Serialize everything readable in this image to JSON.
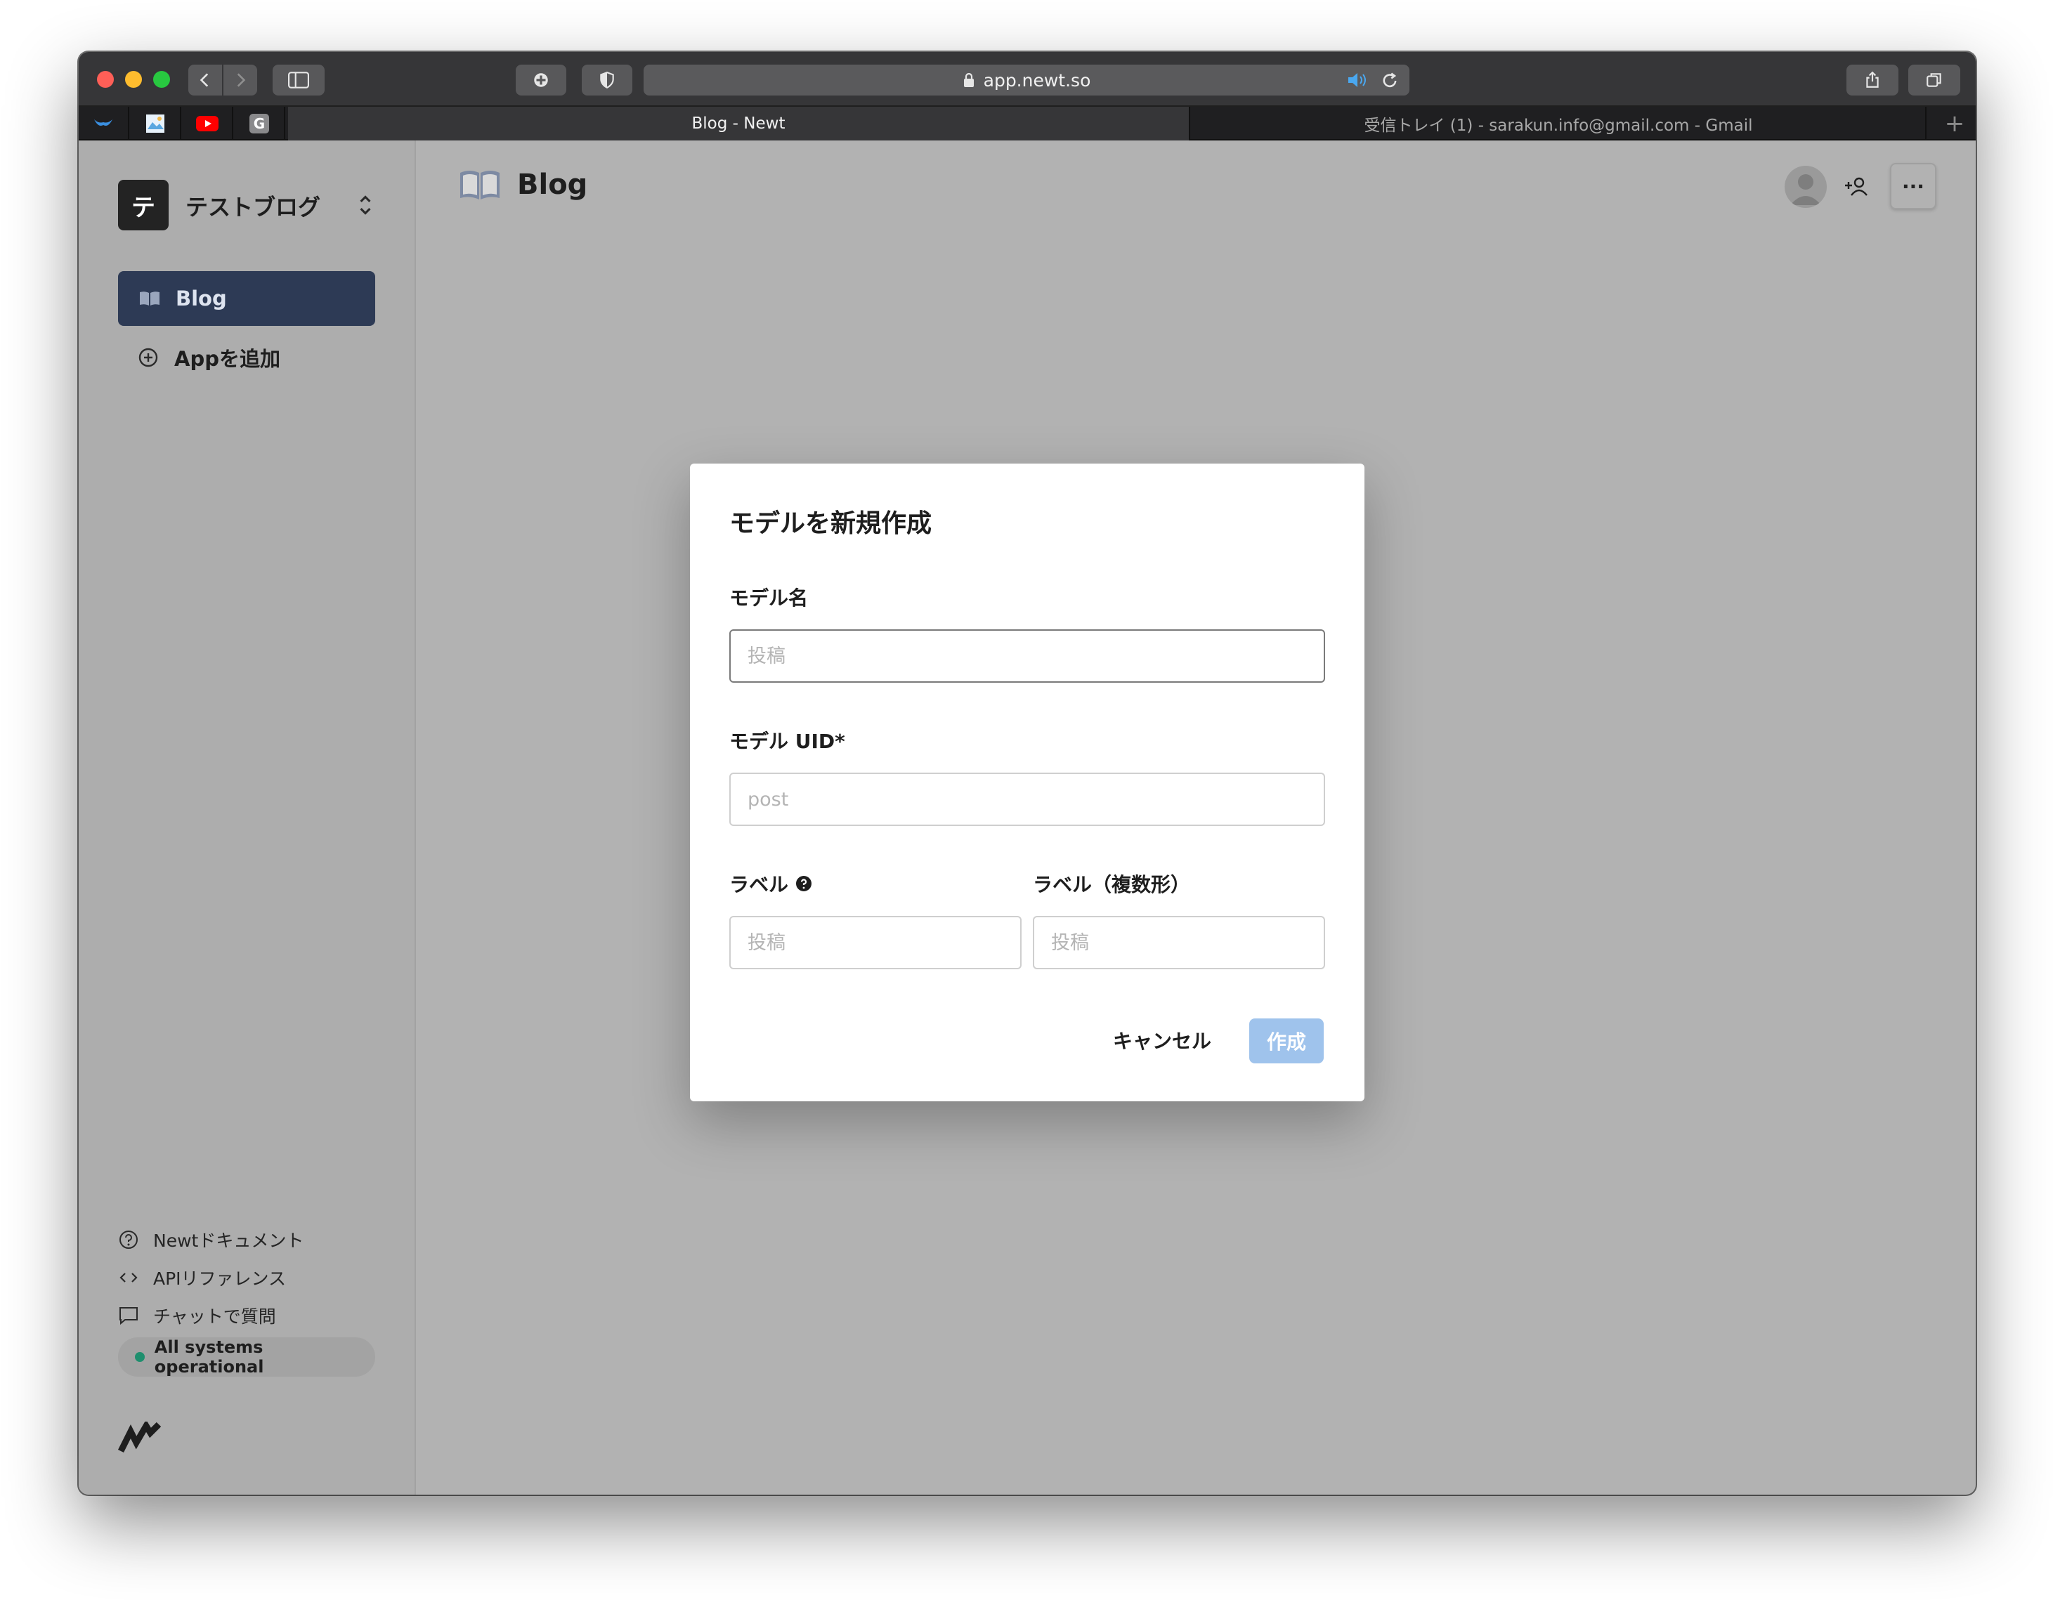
{
  "browser": {
    "url": "app.newt.so",
    "tabs": {
      "active": "Blog - Newt",
      "inactive": "受信トレイ (1) - sarakun.info@gmail.com - Gmail"
    },
    "pinned_tabs": [
      {
        "icon": "bird-icon"
      },
      {
        "icon": "image-icon"
      },
      {
        "icon": "youtube-icon"
      },
      {
        "icon": "g-icon",
        "letter": "G"
      }
    ],
    "new_tab": "+"
  },
  "sidebar": {
    "workspace_initial": "テ",
    "workspace_name": "テストブログ",
    "apps": [
      {
        "label": "Blog",
        "icon": "book-icon",
        "active": true
      }
    ],
    "add_app_label": "Appを追加",
    "links": [
      {
        "label": "Newtドキュメント",
        "icon": "question-circle-icon"
      },
      {
        "label": "APIリファレンス",
        "icon": "code-icon"
      },
      {
        "label": "チャットで質問",
        "icon": "chat-icon"
      }
    ],
    "status_text": "All systems operational",
    "status_color": "#1f8f6e"
  },
  "header": {
    "title": "Blog",
    "more_label": "···"
  },
  "modal": {
    "title": "モデルを新規作成",
    "model_name_label": "モデル名",
    "model_name_placeholder": "投稿",
    "model_uid_label": "モデル UID*",
    "model_uid_placeholder": "post",
    "label_label": "ラベル",
    "label_placeholder": "投稿",
    "label_plural_label": "ラベル（複数形）",
    "label_plural_placeholder": "投稿",
    "cancel_label": "キャンセル",
    "create_label": "作成"
  },
  "colors": {
    "accent_nav": "#2d3a55",
    "create_button": "#9fc3ec",
    "overlay_bg": "#b2b2b2"
  }
}
